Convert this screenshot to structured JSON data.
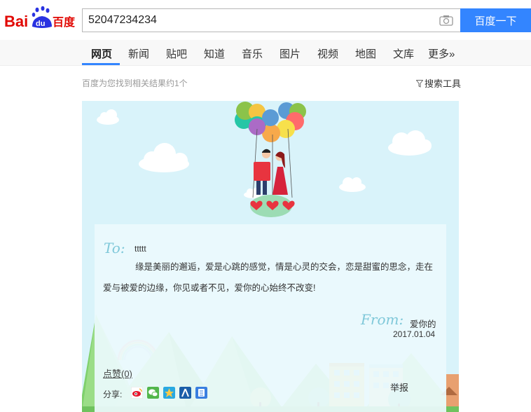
{
  "header": {
    "logo_text_left": "Bai",
    "logo_text_du": "du",
    "logo_text_right": "百度",
    "search_value": "52047234234",
    "search_button_label": "百度一下"
  },
  "nav": {
    "items": [
      {
        "label": "网页",
        "active": true
      },
      {
        "label": "新闻"
      },
      {
        "label": "贴吧"
      },
      {
        "label": "知道"
      },
      {
        "label": "音乐"
      },
      {
        "label": "图片"
      },
      {
        "label": "视频"
      },
      {
        "label": "地图"
      },
      {
        "label": "文库"
      },
      {
        "label": "更多»"
      }
    ]
  },
  "results": {
    "count_text": "百度为您找到相关结果约1个",
    "tools_label": "搜索工具"
  },
  "card": {
    "to_label": "To:",
    "to_name": "ttttt",
    "message": "缘是美丽的邂逅，爱是心跳的感觉，情是心灵的交会，恋是甜蜜的思念，走在爱与被爱的边缘，你见或者不见，爱你的心始终不改变!",
    "from_label": "From:",
    "from_name": "爱你的",
    "date": "2017.01.04",
    "like_label": "点赞(0)",
    "share_label": "分享:",
    "report_label": "举报",
    "share_icons": [
      "weibo-icon",
      "wechat-icon",
      "qzone-icon",
      "renren-icon",
      "tieba-icon"
    ],
    "balloon_colors": [
      "#8bc34a",
      "#f4c542",
      "#26c6a6",
      "#5b9bd5",
      "#ff6b6b",
      "#ab6bc6",
      "#f7e04b",
      "#f7a94b"
    ]
  },
  "colors": {
    "accent": "#3385ff",
    "logo_red": "#e10601",
    "logo_blue": "#2932e1",
    "card_bg": "#d9f3fa"
  }
}
